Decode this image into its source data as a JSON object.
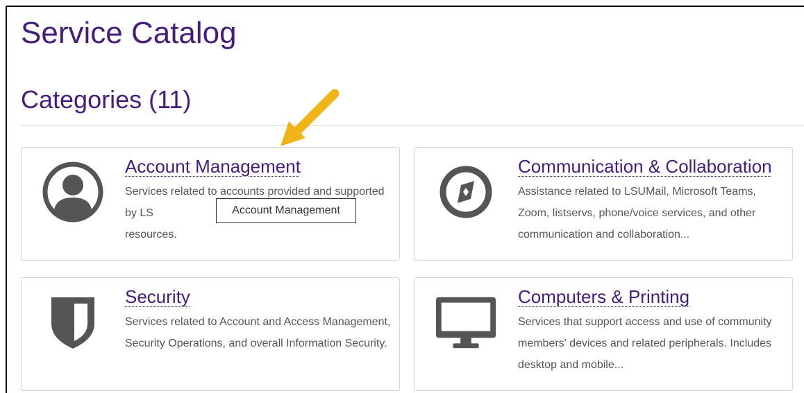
{
  "page": {
    "title": "Service Catalog",
    "categories_heading": "Categories (11)"
  },
  "colors": {
    "heading": "#461d7c",
    "icon": "#555555",
    "description": "#555555",
    "annotation_arrow": "#f0b418"
  },
  "categories": [
    {
      "title": "Account Management",
      "description": "Services related to accounts provided and supported by LS",
      "description_cont": "resources.",
      "icon": "user-circle-icon"
    },
    {
      "title": "Communication & Collaboration",
      "description": "Assistance related to LSUMail, Microsoft Teams, Zoom, listservs, phone/voice services, and other communication and collaboration...",
      "icon": "compass-icon"
    },
    {
      "title": "Security",
      "description": "Services related to Account and Access Management, Security Operations, and overall Information Security.",
      "icon": "shield-icon"
    },
    {
      "title": "Computers & Printing",
      "description": "Services that support access and use of community members' devices and related peripherals. Includes desktop and mobile...",
      "icon": "desktop-monitor-icon"
    }
  ],
  "tooltip": {
    "text": "Account Management"
  }
}
